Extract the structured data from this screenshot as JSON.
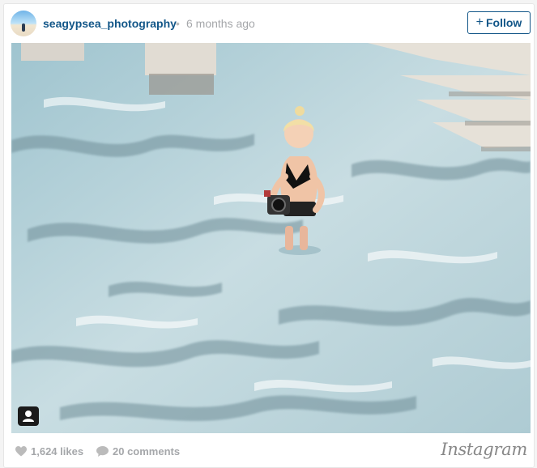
{
  "post": {
    "username": "seagypsea_photography",
    "separator": "•",
    "posted_ago": "6 months ago",
    "follow_label": "Follow",
    "follow_icon": "+"
  },
  "photo": {
    "alt": "Woman in black bikini standing in a clear rock pool holding a camera"
  },
  "footer": {
    "likes": "1,624 likes",
    "comments": "20 comments",
    "brand": "Instagram"
  },
  "colors": {
    "link_blue": "#125688",
    "muted_gray": "#a5a7aa",
    "water": "#bcd4dc"
  },
  "icons": [
    "avatar-image",
    "plus-icon",
    "user-tag-icon",
    "heart-icon",
    "comment-bubble-icon",
    "instagram-logo"
  ]
}
